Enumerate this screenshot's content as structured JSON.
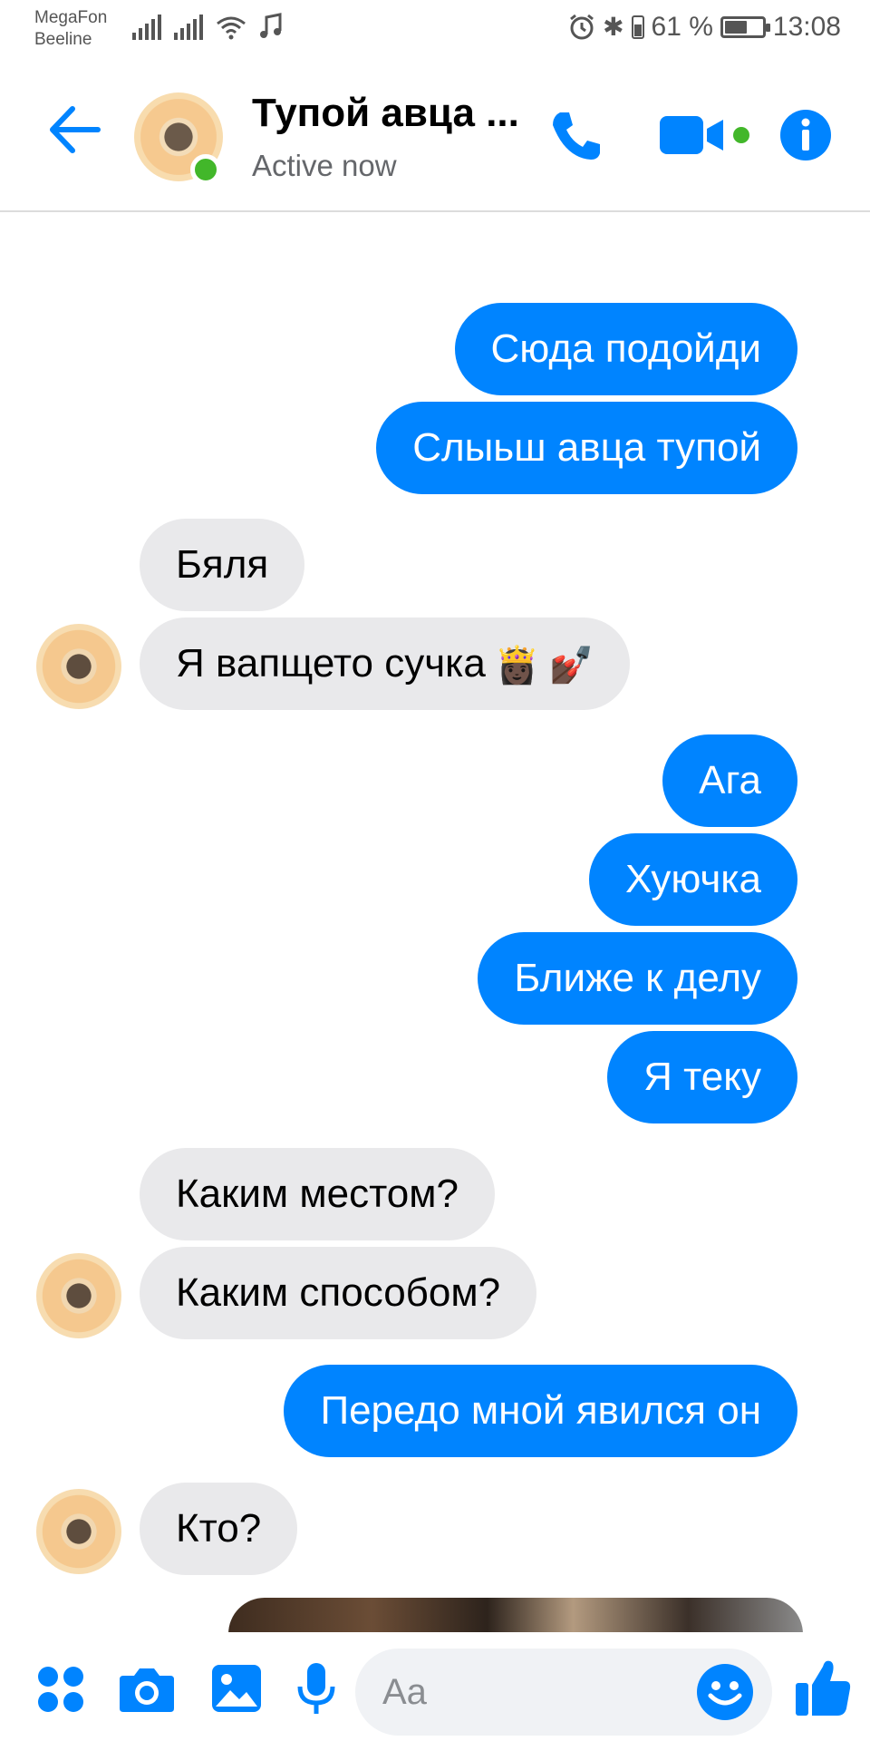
{
  "status_bar": {
    "carrier1": "MegaFon",
    "carrier2": "Beeline",
    "battery_percent": "61 %",
    "battery_level": 0.61,
    "time": "13:08"
  },
  "header": {
    "title": "Тупой авца ...",
    "subtitle": "Active now",
    "icons": [
      "back-arrow-icon",
      "phone-icon",
      "video-call-icon",
      "info-icon"
    ],
    "accent_color": "#0084ff",
    "online_color": "#42b72a"
  },
  "messages": [
    {
      "dir": "out",
      "text": "Сюда подойди"
    },
    {
      "dir": "out",
      "text": "Слыьш авца тупой"
    },
    {
      "dir": "in",
      "text": "Бяля"
    },
    {
      "dir": "in",
      "text": "Я вапщето сучка"
    },
    {
      "dir": "out",
      "text": "Ага"
    },
    {
      "dir": "out",
      "text": "Хуючка"
    },
    {
      "dir": "out",
      "text": "Ближе к делу"
    },
    {
      "dir": "out",
      "text": "Я теку"
    },
    {
      "dir": "in",
      "text": "Каким местом?"
    },
    {
      "dir": "in",
      "text": "Каким способом?"
    },
    {
      "dir": "out",
      "text": "Передо мной явился он"
    },
    {
      "dir": "in",
      "text": "Кто?"
    }
  ],
  "composer": {
    "placeholder": "Aa",
    "icons": [
      "apps-icon",
      "camera-icon",
      "gallery-icon",
      "microphone-icon",
      "emoji-icon",
      "thumbs-up-icon"
    ]
  }
}
